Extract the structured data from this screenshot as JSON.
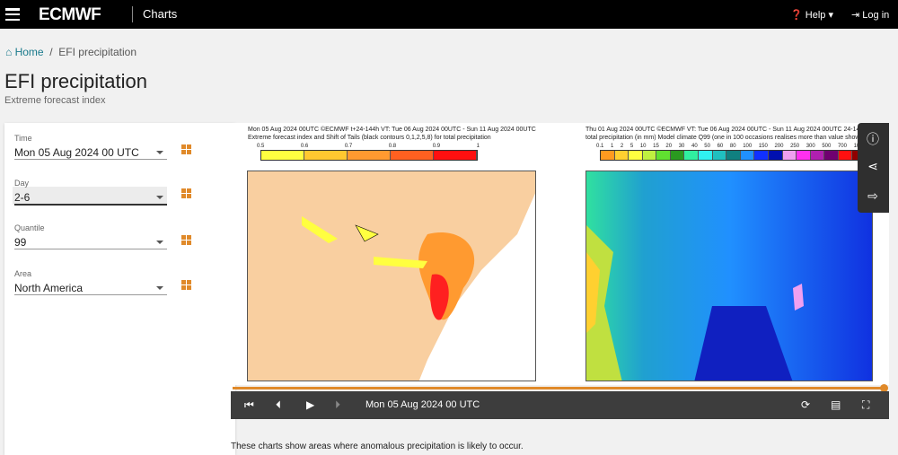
{
  "header": {
    "brand": "ECMWF",
    "section": "Charts",
    "help": "Help",
    "login": "Log in"
  },
  "breadcrumb": {
    "home": "Home",
    "current": "EFI precipitation"
  },
  "page": {
    "title": "EFI precipitation",
    "subtitle": "Extreme forecast index"
  },
  "fields": [
    {
      "label": "Time",
      "value": "Mon 05 Aug 2024 00 UTC"
    },
    {
      "label": "Day",
      "value": "2-6"
    },
    {
      "label": "Quantile",
      "value": "99"
    },
    {
      "label": "Area",
      "value": "North America"
    }
  ],
  "left_chart": {
    "line1": "Mon 05 Aug 2024 00UTC ©ECMWF t+24-144h  VT: Tue 06 Aug 2024 00UTC - Sun 11 Aug 2024 00UTC",
    "line2": "Extreme forecast index and Shift of Tails (black contours 0,1,2,5,8) for total precipitation",
    "ticks": [
      "0.5",
      "0.6",
      "0.7",
      "0.8",
      "0.9",
      "1"
    ],
    "colors": [
      "#ffff40",
      "#ffc830",
      "#ff9a30",
      "#ff6020",
      "#ff1010"
    ]
  },
  "right_chart": {
    "line1": "Thu 01 Aug 2024 00UTC ©ECMWF VT: Tue 06 Aug 2024 00UTC - Sun 11 Aug 2024 00UTC   24-144h",
    "line2": "total precipitation (in mm)  Model climate Q99 (one in 100 occasions realises more than value shown)",
    "ticks": [
      "0.1",
      "1",
      "2",
      "5",
      "10",
      "15",
      "20",
      "30",
      "40",
      "50",
      "60",
      "80",
      "100",
      "150",
      "200",
      "250",
      "300",
      "500",
      "700",
      "1000"
    ],
    "colors": [
      "#ff9a20",
      "#ffd030",
      "#ffff40",
      "#c0f040",
      "#60e030",
      "#2a9a20",
      "#30f0a0",
      "#30f0f0",
      "#20c0c0",
      "#108080",
      "#2090ff",
      "#1030ff",
      "#0010b0",
      "#f0a0f0",
      "#ff30f0",
      "#b020b0",
      "#700070",
      "#ff1010",
      "#900000"
    ]
  },
  "player": {
    "date": "Mon 05 Aug 2024 00 UTC",
    "progress": 1.0
  },
  "description": "These charts show areas where anomalous precipitation is likely to occur."
}
